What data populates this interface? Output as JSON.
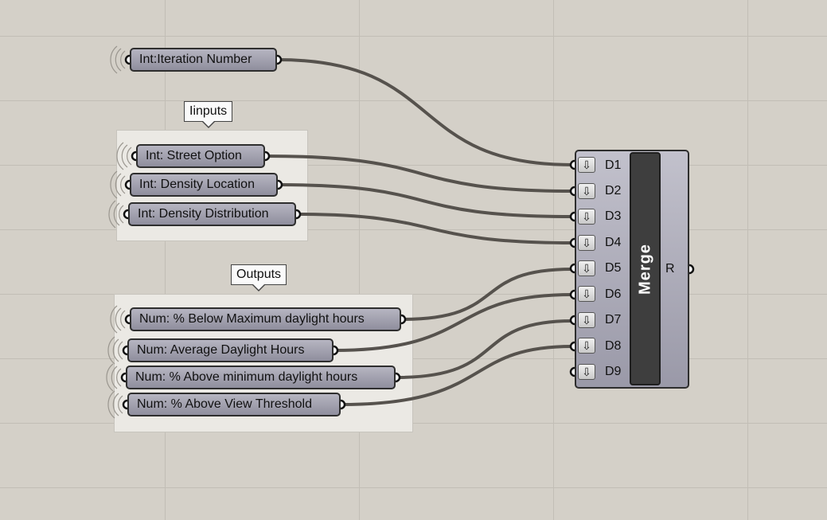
{
  "canvas": {
    "background": "#d4d0c8",
    "wire_color": "#56524d"
  },
  "groups": {
    "inputs": {
      "label": "Iinputs"
    },
    "outputs": {
      "label": "Outputs"
    }
  },
  "sliders": {
    "iteration": "Int:Iteration Number",
    "street_option": "Int: Street Option",
    "density_location": "Int: Density Location",
    "density_distribution": "Int: Density Distribution",
    "below_max_daylight": "Num: % Below Maximum daylight hours",
    "average_daylight": "Num: Average Daylight Hours",
    "above_min_daylight": "Num: % Above minimum daylight hours",
    "above_view_threshold": "Num: % Above View Threshold"
  },
  "merge": {
    "title": "Merge",
    "inputs": [
      "D1",
      "D2",
      "D3",
      "D4",
      "D5",
      "D6",
      "D7",
      "D8",
      "D9"
    ],
    "output": "R",
    "param_icon": "arrow-down-icon"
  }
}
